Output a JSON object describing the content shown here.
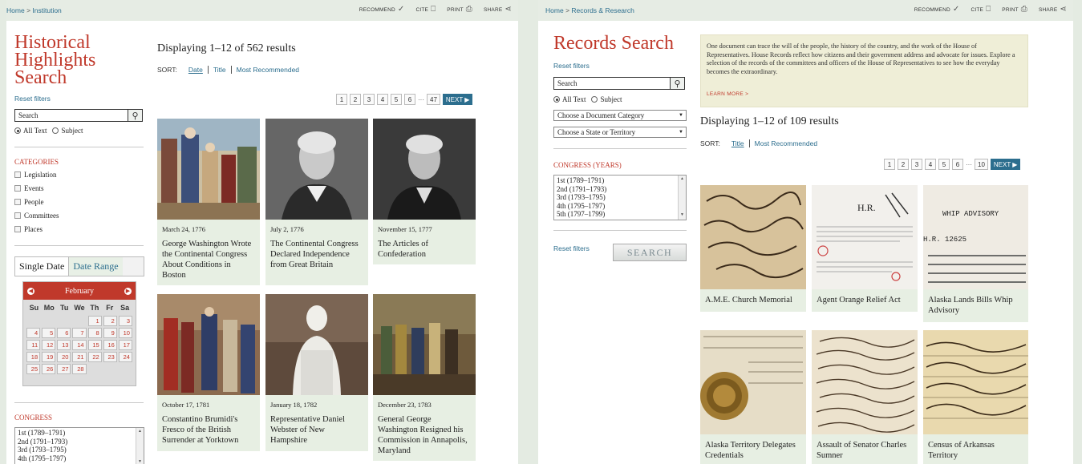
{
  "left": {
    "breadcrumb": {
      "home": "Home",
      "sep": ">",
      "current": "Institution"
    },
    "actions": {
      "recommend": "RECOMMEND",
      "cite": "CITE",
      "print": "PRINT",
      "share": "SHARE"
    },
    "title_lines": [
      "Historical",
      "Highlights",
      "Search"
    ],
    "reset_filters": "Reset filters",
    "search_placeholder": "Search",
    "radio_all": "All Text",
    "radio_subject": "Subject",
    "categories_title": "CATEGORIES",
    "categories": [
      "Legislation",
      "Events",
      "People",
      "Committees",
      "Places"
    ],
    "date_tabs": {
      "single": "Single Date",
      "range": "Date Range"
    },
    "calendar": {
      "month": "February",
      "day_names": [
        "Su",
        "Mo",
        "Tu",
        "We",
        "Th",
        "Fr",
        "Sa"
      ],
      "days": [
        "",
        "",
        "",
        "",
        "1",
        "2",
        "3",
        "4",
        "5",
        "6",
        "7",
        "8",
        "9",
        "10",
        "11",
        "12",
        "13",
        "14",
        "15",
        "16",
        "17",
        "18",
        "19",
        "20",
        "21",
        "22",
        "23",
        "24",
        "25",
        "26",
        "27",
        "28"
      ]
    },
    "congress_title": "CONGRESS",
    "congress_list": [
      "1st (1789–1791)",
      "2nd (1791–1793)",
      "3rd (1793–1795)",
      "4th (1795–1797)"
    ],
    "results_text": "Displaying 1–12 of 562 results",
    "sort": {
      "label": "SORT:",
      "options": [
        "Date",
        "Title",
        "Most Recommended"
      ]
    },
    "pager": {
      "pages": [
        "1",
        "2",
        "3",
        "4",
        "5",
        "6"
      ],
      "ellipsis": "···",
      "last": "47",
      "next": "NEXT"
    },
    "cards": [
      {
        "date": "March 24, 1776",
        "title": "George Washington Wrote the Continental Congress About Conditions in Boston"
      },
      {
        "date": "July 2, 1776",
        "title": "The Continental Congress Declared Independence from Great Britain"
      },
      {
        "date": "November 15, 1777",
        "title": "The Articles of Confederation"
      },
      {
        "date": "October 17, 1781",
        "title": "Constantino Brumidi's Fresco of the British Surrender at Yorktown"
      },
      {
        "date": "January 18, 1782",
        "title": "Representative Daniel Webster of New Hampshire"
      },
      {
        "date": "December 23, 1783",
        "title": "General George Washington Resigned his Commission in Annapolis, Maryland"
      }
    ]
  },
  "right": {
    "breadcrumb": {
      "home": "Home",
      "sep": ">",
      "current": "Records & Research"
    },
    "actions": {
      "recommend": "RECOMMEND",
      "cite": "CITE",
      "print": "PRINT",
      "share": "SHARE"
    },
    "title": "Records Search",
    "reset_filters": "Reset filters",
    "search_placeholder": "Search",
    "radio_all": "All Text",
    "radio_subject": "Subject",
    "select_category": "Choose a Document Category",
    "select_state": "Choose a State or Territory",
    "congress_title": "CONGRESS (YEARS)",
    "congress_list": [
      "1st (1789–1791)",
      "2nd (1791–1793)",
      "3rd (1793–1795)",
      "4th (1795–1797)",
      "5th (1797–1799)"
    ],
    "reset_filters_bottom": "Reset filters",
    "search_button": "SEARCH",
    "intro_text": "One document can trace the will of the people, the history of the country, and the work of the House of Representatives. House Records reflect how citizens and their government address and advocate for issues. Explore a selection of the records of the committees and officers of the House of Representatives to see how the everyday becomes the extraordinary.",
    "learn_more": "LEARN MORE >",
    "results_text": "Displaying 1–12 of 109 results",
    "sort": {
      "label": "SORT:",
      "options": [
        "Title",
        "Most Recommended"
      ]
    },
    "pager": {
      "pages": [
        "1",
        "2",
        "3",
        "4",
        "5",
        "6"
      ],
      "ellipsis": "···",
      "last": "10",
      "next": "NEXT"
    },
    "doc_texts": {
      "hr": "H.R.",
      "whip": "WHIP ADVISORY",
      "hr_num": "H.R. 12625"
    },
    "cards": [
      {
        "title": "A.M.E. Church Memorial"
      },
      {
        "title": "Agent Orange Relief Act"
      },
      {
        "title": "Alaska Lands Bills Whip Advisory"
      },
      {
        "title": "Alaska Territory Delegates Credentials"
      },
      {
        "title": "Assault of Senator Charles Sumner"
      },
      {
        "title": "Census of Arkansas Territory"
      }
    ]
  },
  "colors": {
    "accent_red": "#c0392b",
    "link_blue": "#2c6e8e",
    "card_green": "#e7efe3",
    "page_bg": "#e4ebe2"
  }
}
